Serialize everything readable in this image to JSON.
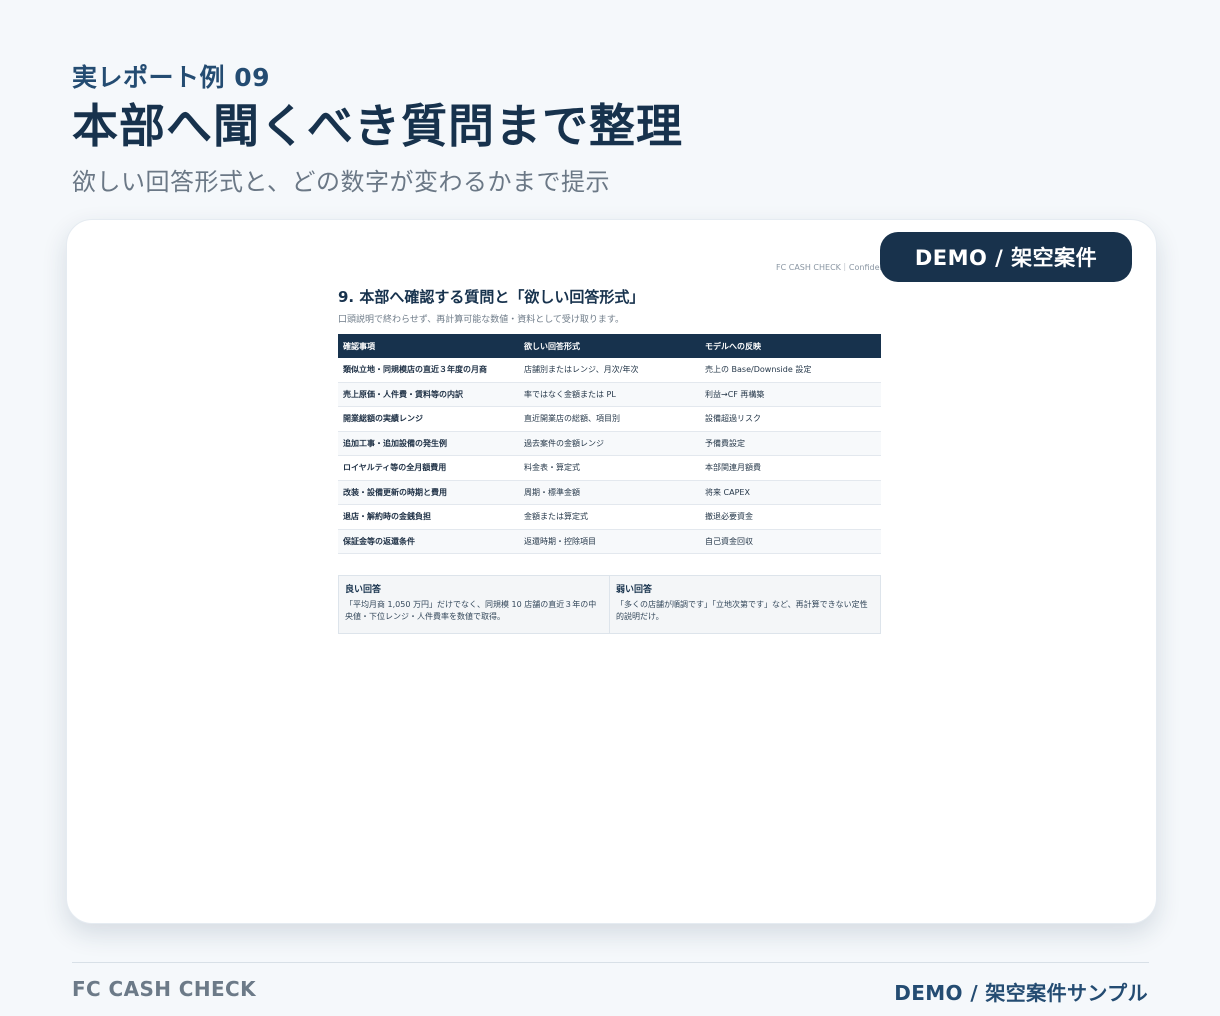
{
  "header": {
    "eyebrow": "実レポート例 09",
    "title": "本部へ聞くべき質問まで整理",
    "subtitle": "欲しい回答形式と、どの数字が変わるかまで提示"
  },
  "badge": {
    "label": "DEMO / 架空案件"
  },
  "report": {
    "header": "FC CASH CHECK｜Confidential",
    "title": "9. 本部へ確認する質問と「欲しい回答形式」",
    "note": "口頭説明で終わらせず、再計算可能な数値・資料として受け取ります。",
    "columns": [
      "確認事項",
      "欲しい回答形式",
      "モデルへの反映"
    ],
    "rows": [
      [
        "類似立地・同規模店の直近３年度の月商",
        "店舗別またはレンジ、月次/年次",
        "売上の Base/Downside 設定"
      ],
      [
        "売上原価・人件費・賃料等の内訳",
        "率ではなく金額または PL",
        "利益→CF 再構築"
      ],
      [
        "開業総額の実績レンジ",
        "直近開業店の総額、項目別",
        "設備超過リスク"
      ],
      [
        "追加工事・追加設備の発生例",
        "過去案件の金額レンジ",
        "予備費設定"
      ],
      [
        "ロイヤルティ等の全月額費用",
        "料金表・算定式",
        "本部関連月額費"
      ],
      [
        "改装・設備更新の時期と費用",
        "周期・標準金額",
        "将来 CAPEX"
      ],
      [
        "退店・解約時の金銭負担",
        "金額または算定式",
        "撤退必要資金"
      ],
      [
        "保証金等の返還条件",
        "返還時期・控除項目",
        "自己資金回収"
      ]
    ],
    "good": {
      "title": "良い回答",
      "text": "「平均月商 1,050 万円」だけでなく、同規模 10 店舗の直近３年の中央値・下位レンジ・人件費率を数値で取得。"
    },
    "bad": {
      "title": "弱い回答",
      "text": "「多くの店舗が順調です」「立地次第です」など、再計算できない定性的説明だけ。"
    }
  },
  "footer": {
    "left": "FC CASH CHECK",
    "right": "DEMO / 架空案件サンプル"
  }
}
